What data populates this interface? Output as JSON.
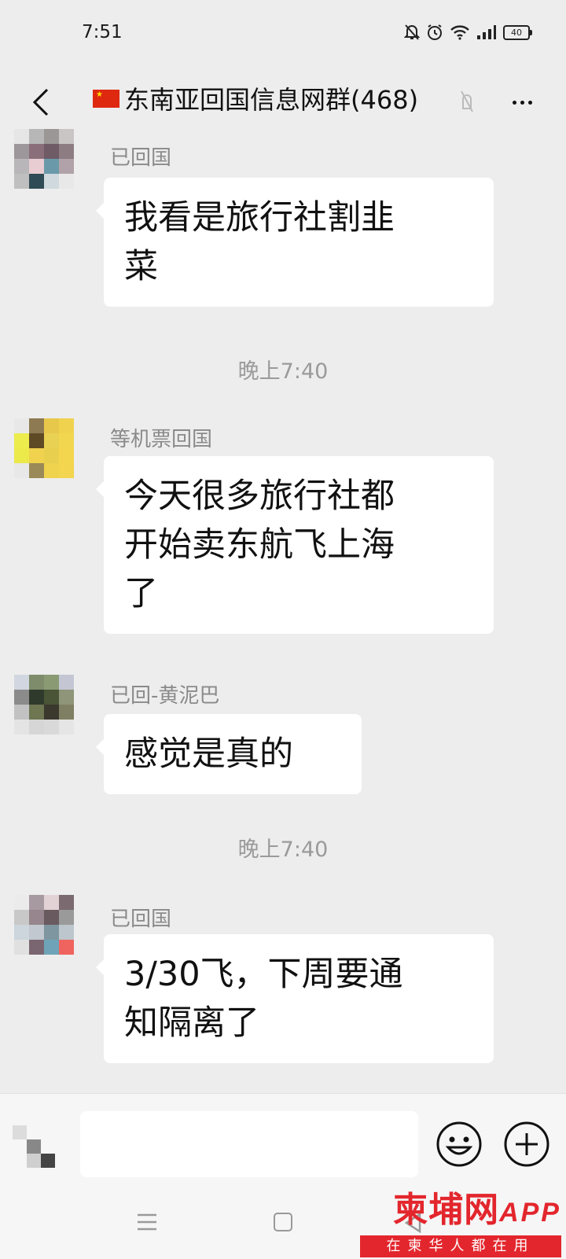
{
  "status_bar": {
    "time": "7:51",
    "battery": "40",
    "icons": [
      "bell-off-icon",
      "alarm-icon",
      "wifi-icon",
      "signal-icon",
      "battery-icon"
    ]
  },
  "header": {
    "title": "东南亚回国信息网群(468)",
    "flag": "china-flag",
    "icons": [
      "back-arrow-icon",
      "mute-icon",
      "more-icon"
    ]
  },
  "messages": [
    {
      "sender": "已回国",
      "text_lines": [
        "我看是旅行社割韭",
        "菜"
      ]
    },
    {
      "time_divider": "晚上7:40"
    },
    {
      "sender": "等机票回国",
      "text_lines": [
        "今天很多旅行社都",
        "开始卖东航飞上海",
        "了"
      ]
    },
    {
      "sender": "已回-黄泥巴",
      "text_lines": [
        "感觉是真的"
      ]
    },
    {
      "time_divider": "晚上7:40"
    },
    {
      "sender": "已回国",
      "text_lines": [
        "3/30飞，下周要通",
        "知隔离了"
      ]
    }
  ],
  "input_bar": {
    "placeholder": "",
    "icons": [
      "voice-icon",
      "emoji-icon",
      "plus-icon"
    ]
  },
  "nav_bar": {
    "icons": [
      "menu-icon",
      "home-icon",
      "back-icon"
    ]
  },
  "watermark": {
    "logo": "柬埔网",
    "app": "APP",
    "slogan": "在柬华人都在用"
  },
  "colors": {
    "background": "#ededed",
    "bubble": "#ffffff",
    "watermark": "#e3262d"
  }
}
